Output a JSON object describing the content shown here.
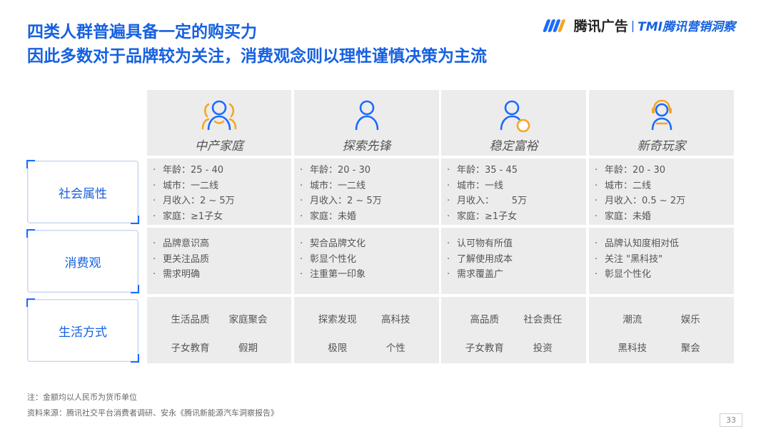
{
  "title": {
    "line1": "四类人群普遍具备一定的购买力",
    "line2": "因此多数对于品牌较为关注，消费观念则以理性谨慎决策为主流"
  },
  "logo": {
    "brand": "腾讯广告",
    "separator": "|",
    "sub": "TMI腾讯营销洞察",
    "colors": [
      "#1a6bff",
      "#f5a623"
    ]
  },
  "rows": [
    {
      "label": "社会属性"
    },
    {
      "label": "消费观"
    },
    {
      "label": "生活方式"
    }
  ],
  "personas": [
    {
      "name": "中产家庭",
      "icon": "family-user-icon",
      "social": [
        "年龄：25 - 40",
        "城市：一二线",
        "月收入：2 ~ 5万",
        "家庭：≥1子女"
      ],
      "consumption": [
        "品牌意识高",
        "更关注品质",
        "需求明确"
      ],
      "lifestyle": [
        "生活品质",
        "家庭聚会",
        "子女教育",
        "假期"
      ]
    },
    {
      "name": "探索先锋",
      "icon": "user-icon",
      "social": [
        "年龄：20 - 30",
        "城市：一二线",
        "月收入：2 ~ 5万",
        "家庭：未婚"
      ],
      "consumption": [
        "契合品牌文化",
        "彰显个性化",
        "注重第一印象"
      ],
      "lifestyle": [
        "探索发现",
        "高科技",
        "极限",
        "个性"
      ]
    },
    {
      "name": "稳定富裕",
      "icon": "wealthy-user-icon",
      "social": [
        "年龄：35 - 45",
        "城市：一线",
        "月收入：      5万",
        "家庭：≥1子女"
      ],
      "consumption": [
        "认可物有所值",
        "了解使用成本",
        "需求覆盖广"
      ],
      "lifestyle": [
        "高品质",
        "社会责任",
        "子女教育",
        "投资"
      ]
    },
    {
      "name": "新奇玩家",
      "icon": "headset-user-icon",
      "social": [
        "年龄：20 - 30",
        "城市：二线",
        "月收入：0.5 ~ 2万",
        "家庭：未婚"
      ],
      "consumption": [
        "品牌认知度相对低",
        "关注 \"黑科技\"",
        "彰显个性化"
      ],
      "lifestyle": [
        "潮流",
        "娱乐",
        "黑科技",
        "聚会"
      ]
    }
  ],
  "footnotes": {
    "note": "注：金额均以人民币为货币单位",
    "source": "资料来源：腾讯社交平台消费者调研、安永《腾讯新能源汽车洞察报告》"
  },
  "page_number": "33",
  "colors": {
    "accent": "#1661e0",
    "accent_orange": "#f5a623",
    "cell_bg": "#ececec"
  }
}
